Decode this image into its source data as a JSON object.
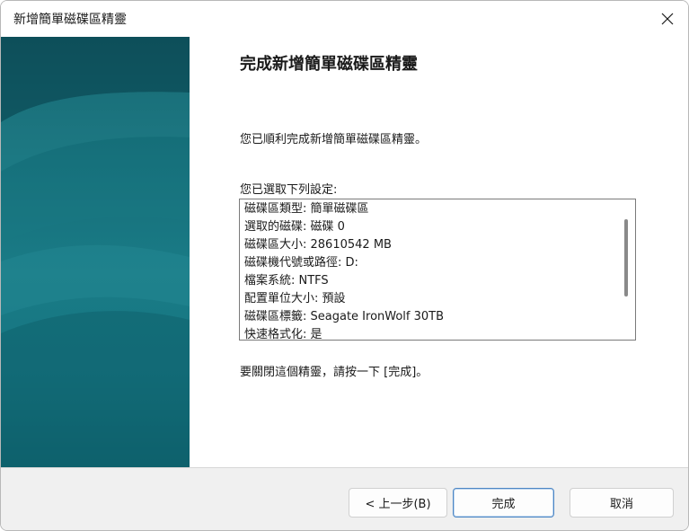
{
  "window": {
    "title": "新增簡單磁碟區精靈"
  },
  "content": {
    "heading": "完成新增簡單磁碟區精靈",
    "success_text": "您已順利完成新增簡單磁碟區精靈。",
    "settings_label": "您已選取下列設定:",
    "settings": [
      "磁碟區類型: 簡單磁碟區",
      "選取的磁碟: 磁碟 0",
      "磁碟區大小: 28610542 MB",
      "磁碟機代號或路徑: D:",
      "檔案系統: NTFS",
      "配置單位大小: 預設",
      "磁碟區標籤: Seagate IronWolf 30TB",
      "快速格式化: 是"
    ],
    "close_instruction": "要關閉這個精靈，請按一下 [完成]。"
  },
  "footer": {
    "back_label": "< 上一步(B)",
    "finish_label": "完成",
    "cancel_label": "取消"
  },
  "icons": {
    "close": "close-icon"
  },
  "colors": {
    "banner_dark": "#0f5560",
    "banner_light": "#1a7c87",
    "default_button_border": "#4e87c4"
  }
}
